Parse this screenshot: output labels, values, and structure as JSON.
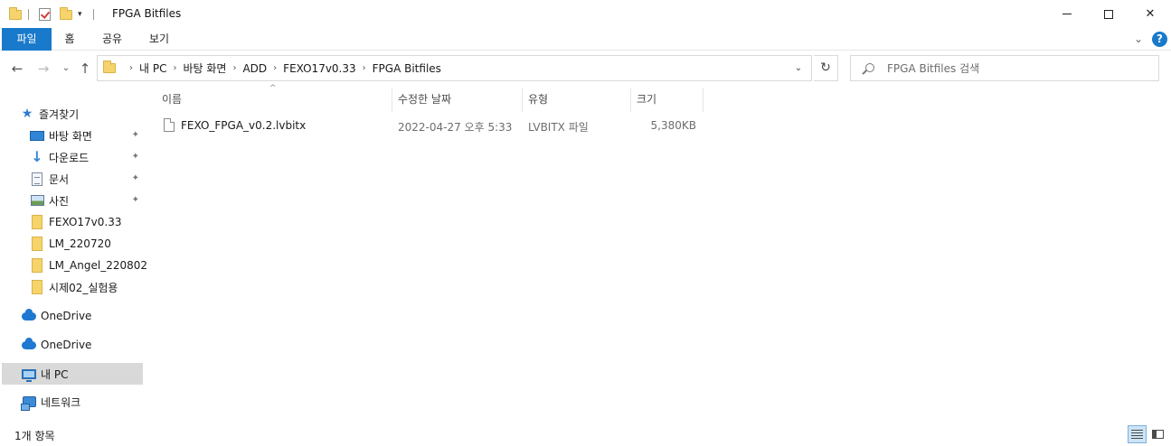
{
  "window": {
    "title": "FPGA Bitfiles",
    "minimize_glyph": "",
    "close_glyph": "✕"
  },
  "ribbon": {
    "tabs": [
      {
        "label": "파일"
      },
      {
        "label": "홈"
      },
      {
        "label": "공유"
      },
      {
        "label": "보기"
      }
    ],
    "help_glyph": "?",
    "expand_glyph": "⌄"
  },
  "nav_buttons": {
    "back": "←",
    "forward": "→",
    "recent": "⌄",
    "up": "↑"
  },
  "address": {
    "crumbs": [
      "내 PC",
      "바탕 화면",
      "ADD",
      "FEXO17v0.33",
      "FPGA Bitfiles"
    ],
    "separator": "›",
    "dropdown_glyph": "⌄",
    "refresh_glyph": "↻"
  },
  "search": {
    "placeholder": "FPGA Bitfiles 검색"
  },
  "navpane": {
    "quick_access": "즐겨찾기",
    "pinned": [
      {
        "label": "바탕 화면",
        "icon": "desktop-icon"
      },
      {
        "label": "다운로드",
        "icon": "download-icon"
      },
      {
        "label": "문서",
        "icon": "documents-icon"
      },
      {
        "label": "사진",
        "icon": "pictures-icon"
      }
    ],
    "folders": [
      {
        "label": "FEXO17v0.33"
      },
      {
        "label": "LM_220720"
      },
      {
        "label": "LM_Angel_220802"
      },
      {
        "label": "시제02_실험용"
      }
    ],
    "onedrive_1": "OneDrive",
    "onedrive_2": "OneDrive",
    "this_pc": "내 PC",
    "network": "네트워크",
    "pin_glyph": "📌"
  },
  "columns": {
    "name": "이름",
    "date": "수정한 날짜",
    "type": "유형",
    "size": "크기",
    "sort_glyph": "^"
  },
  "files": [
    {
      "name": "FEXO_FPGA_v0.2.lvbitx",
      "date": "2022-04-27 오후 5:33",
      "type": "LVBITX 파일",
      "size": "5,380KB"
    }
  ],
  "status": {
    "item_count": "1개 항목"
  },
  "colors": {
    "accent": "#1979ca",
    "folder": "#f6d36b",
    "selected_nav": "#d9d9d9"
  }
}
